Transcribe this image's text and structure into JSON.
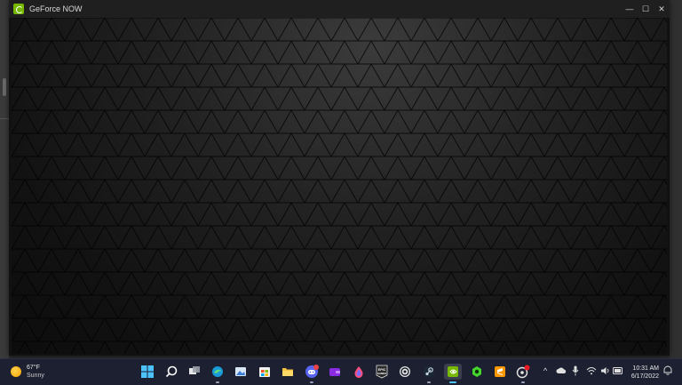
{
  "window": {
    "title": "GeForce NOW",
    "controls": {
      "minimize": "—",
      "maximize": "☐",
      "close": "✕"
    }
  },
  "taskbar": {
    "weather": {
      "temperature": "67°F",
      "condition": "Sunny",
      "icon": "sun-icon"
    },
    "apps": [
      {
        "name": "start-icon"
      },
      {
        "name": "search-icon"
      },
      {
        "name": "task-view-icon"
      },
      {
        "name": "edge-icon"
      },
      {
        "name": "photos-icon"
      },
      {
        "name": "store-icon"
      },
      {
        "name": "file-explorer-icon"
      },
      {
        "name": "discord-icon",
        "badge": "9+"
      },
      {
        "name": "wallet-app-icon"
      },
      {
        "name": "drop-app-icon"
      },
      {
        "name": "epic-games-icon",
        "label": "EPIC\nGAMES"
      },
      {
        "name": "ubisoft-icon"
      },
      {
        "name": "steam-icon"
      },
      {
        "name": "geforce-now-icon"
      },
      {
        "name": "razer-icon"
      },
      {
        "name": "sublime-text-icon"
      },
      {
        "name": "settings-app-icon"
      }
    ],
    "tray": {
      "chevron": "^",
      "icons": [
        "chevron-up-icon",
        "cloud-icon",
        "microphone-icon",
        "wifi-icon",
        "volume-icon",
        "battery-icon"
      ]
    },
    "clock": {
      "time": "10:31 AM",
      "date": "6/17/2022"
    }
  },
  "colors": {
    "nvidia_green": "#76b900",
    "taskbar_bg": "#1d2030",
    "titlebar_bg": "#1f1f1f"
  }
}
